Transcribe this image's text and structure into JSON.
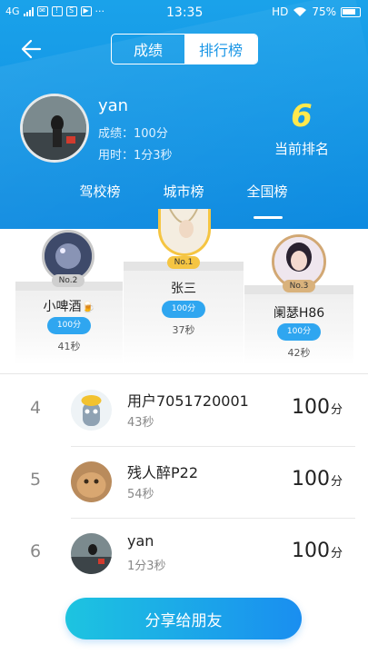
{
  "status_bar": {
    "network": "4G",
    "time": "13:35",
    "hd": "HD",
    "battery": "75%"
  },
  "header": {
    "tabs": [
      "成绩",
      "排行榜"
    ],
    "active_tab": "排行榜"
  },
  "me": {
    "name": "yan",
    "score_text": "成绩：100分",
    "time_text": "用时：1分3秒",
    "rank": "6",
    "rank_label": "当前排名"
  },
  "boards": {
    "items": [
      "驾校榜",
      "城市榜",
      "全国榜"
    ],
    "active": "全国榜"
  },
  "podium": {
    "first": {
      "badge": "No.1",
      "name": "张三",
      "score": "100分",
      "time": "37秒"
    },
    "second": {
      "badge": "No.2",
      "name": "小啤酒",
      "score": "100分",
      "time": "41秒"
    },
    "third": {
      "badge": "No.3",
      "name": "阑瑟H86",
      "score": "100分",
      "time": "42秒"
    }
  },
  "list": [
    {
      "rank": "4",
      "name": "用户7051720001",
      "time": "43秒",
      "score": "100",
      "unit": "分"
    },
    {
      "rank": "5",
      "name": "残人醉P22",
      "time": "54秒",
      "score": "100",
      "unit": "分"
    },
    {
      "rank": "6",
      "name": "yan",
      "time": "1分3秒",
      "score": "100",
      "unit": "分"
    }
  ],
  "share_button": "分享给朋友",
  "colors": {
    "header_blue": "#0d8ae0",
    "rank_yellow": "#ffe94d",
    "pill_blue": "#2fa6f0",
    "share_gradient_start": "#1dc4e0",
    "share_gradient_end": "#1a8ef0"
  }
}
